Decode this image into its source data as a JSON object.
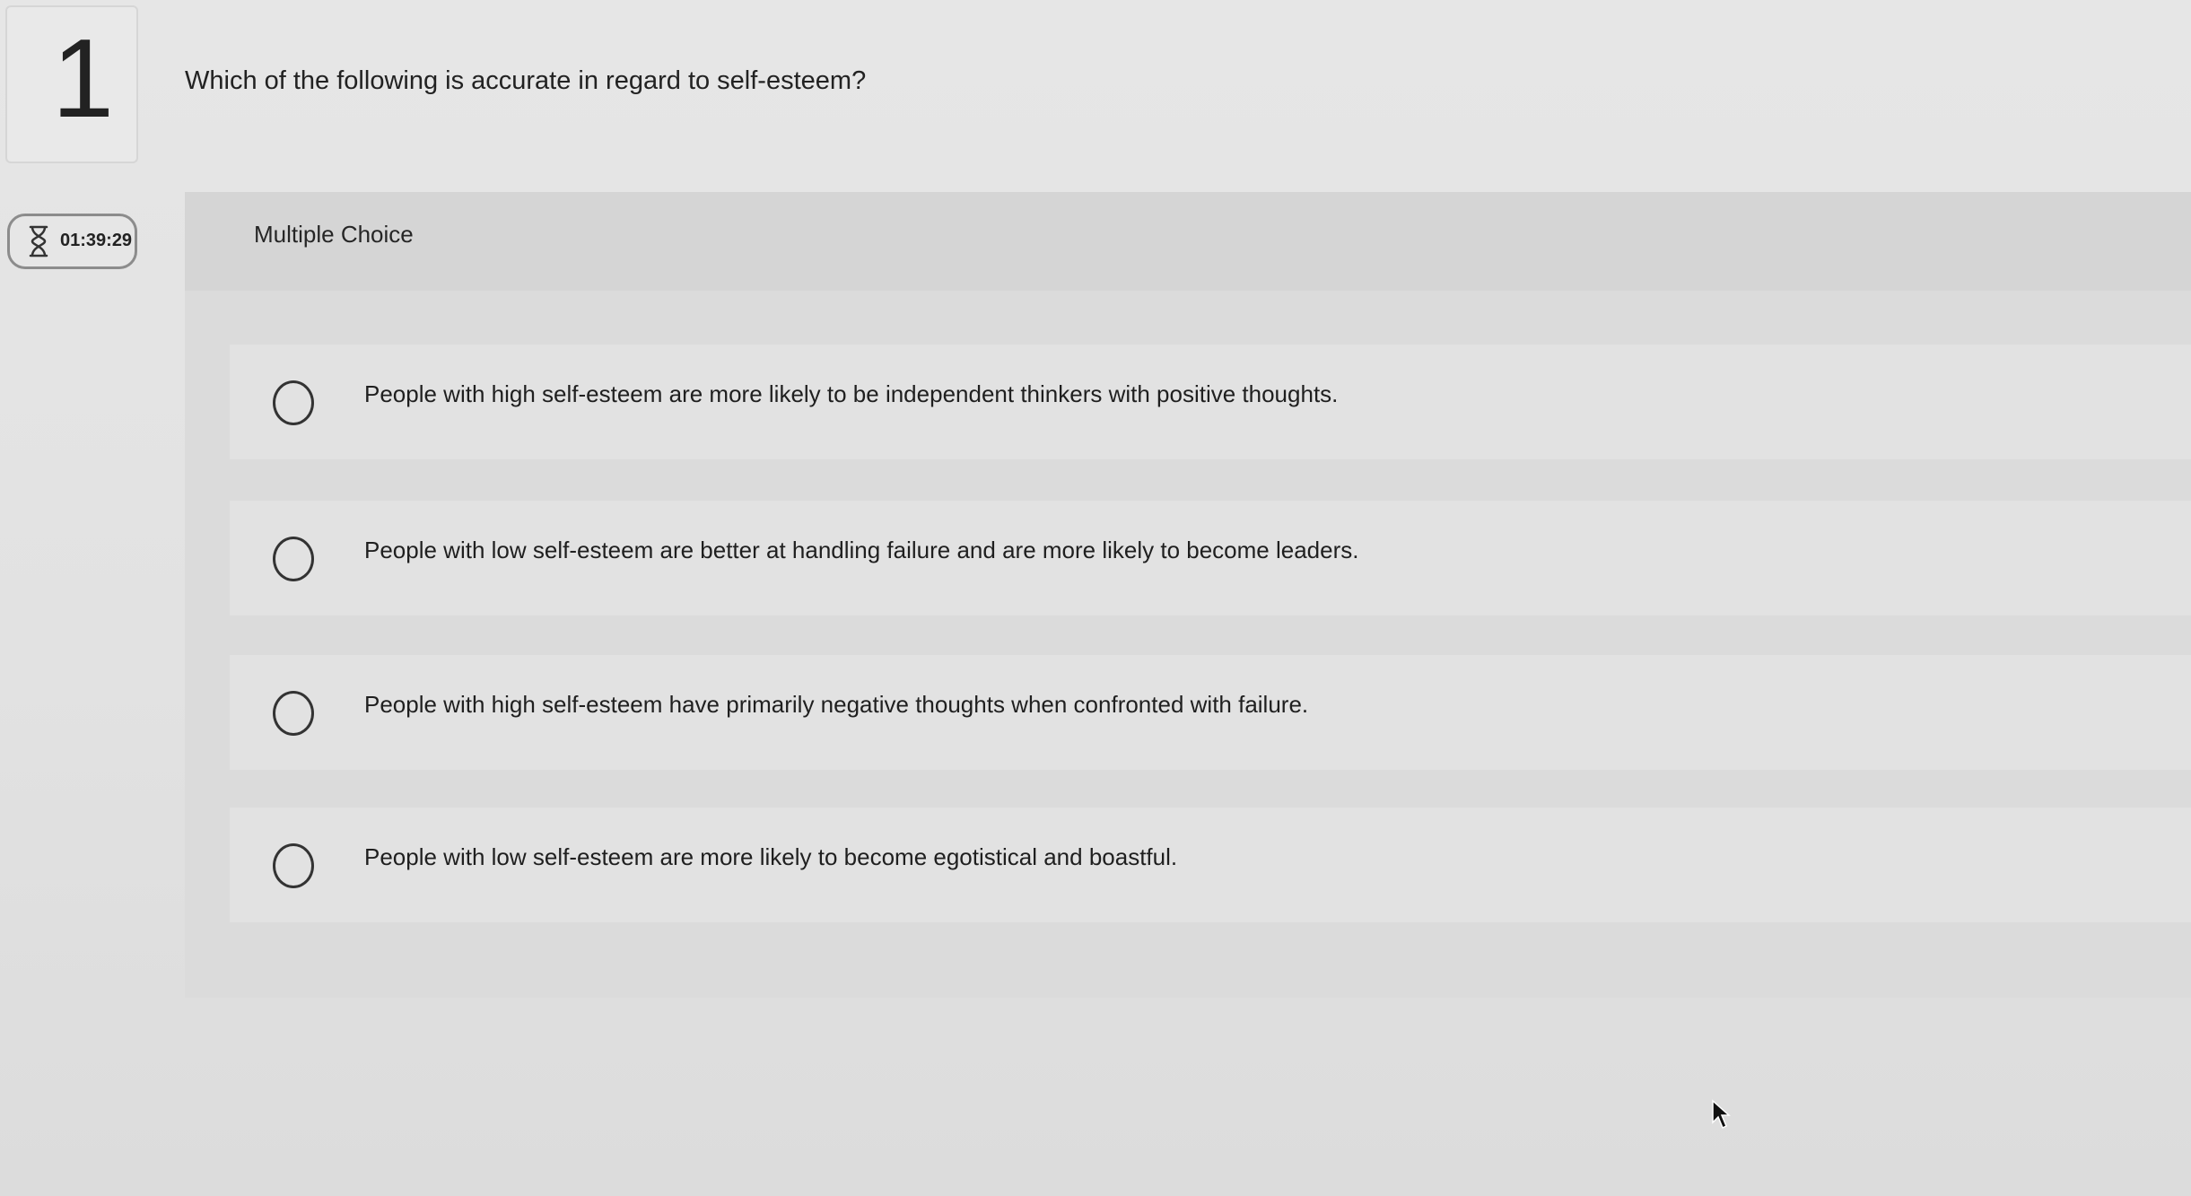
{
  "question": {
    "number": "1",
    "text": "Which of the following is accurate in regard to self-esteem?",
    "type_label": "Multiple Choice"
  },
  "timer": {
    "icon": "hourglass-icon",
    "time": "01:39:29"
  },
  "choices": [
    {
      "label": "People with high self-esteem are more likely to be independent thinkers with positive thoughts."
    },
    {
      "label": "People with low self-esteem are better at handling failure and are more likely to become leaders."
    },
    {
      "label": "People with high self-esteem have primarily negative thoughts when confronted with failure."
    },
    {
      "label": "People with low self-esteem are more likely to become egotistical and boastful."
    }
  ]
}
